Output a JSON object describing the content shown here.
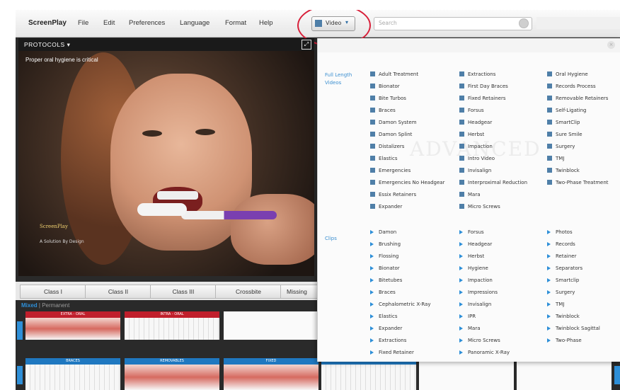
{
  "app": {
    "brand": "ScreenPlay"
  },
  "menu": [
    "File",
    "Edit",
    "Preferences",
    "Language",
    "Format",
    "Help"
  ],
  "media_select": {
    "value": "Video"
  },
  "search": {
    "placeholder": "Search"
  },
  "video": {
    "protocols_label": "PROTOCOLS ▾",
    "caption": "Proper oral hygiene is critical",
    "logo_text": "ScreenPlay",
    "logo_sub": "A Solution By Design"
  },
  "class_tabs": [
    "Class I",
    "Class II",
    "Class III",
    "Crossbite",
    "Missing"
  ],
  "dentition_tabs": {
    "active": "Mixed",
    "inactive": "Permanent"
  },
  "thumbnails_row1": [
    "EXTRA - ORAL",
    "INTRA - ORAL"
  ],
  "thumbnails_row2": [
    "BRACES",
    "REMOVABLES",
    "FIXED",
    "EXTRACTIONS"
  ],
  "colors": {
    "accent_blue": "#2e8fd8",
    "header_red": "#c01f2c",
    "circle_red": "#d8203a"
  },
  "dropdown": {
    "full_length_label": "Full Length Videos",
    "full_length": [
      [
        "Adult Treatment",
        "Bionator",
        "Bite Turbos",
        "Braces",
        "Damon System",
        "Damon Splint",
        "Distalizers",
        "Elastics",
        "Emergencies",
        "Emergencies No Headgear",
        "Essix Retainers",
        "Expander"
      ],
      [
        "Extractions",
        "First Day Braces",
        "Fixed Retainers",
        "Forsus",
        "Headgear",
        "Herbst",
        "Impaction",
        "Intro Video",
        "Invisalign",
        "Interproximal Reduction",
        "Mara",
        "Micro Screws"
      ],
      [
        "Oral Hygiene",
        "Records Process",
        "Removable Retainers",
        "Self-Ligating",
        "SmartClip",
        "Sure Smile",
        "Surgery",
        "TMJ",
        "Twinblock",
        "Two-Phase Treatment"
      ]
    ],
    "clips_label": "Clips",
    "clips": [
      [
        "Damon",
        "Brushing",
        "Flossing",
        "Bionator",
        "Bitetubes",
        "Braces",
        "Cephalometric X-Ray",
        "Elastics",
        "Expander",
        "Extractions",
        "Fixed Retainer"
      ],
      [
        "Forsus",
        "Headgear",
        "Herbst",
        "Hygiene",
        "Impaction",
        "Impressions",
        "Invisalign",
        "IPR",
        "Mara",
        "Micro Screws",
        "Panoramic X-Ray"
      ],
      [
        "Photos",
        "Records",
        "Retainer",
        "Separators",
        "Smartclip",
        "Surgery",
        "TMJ",
        "Twinblock",
        "Twinblock Sagittal",
        "Two-Phase"
      ]
    ]
  }
}
